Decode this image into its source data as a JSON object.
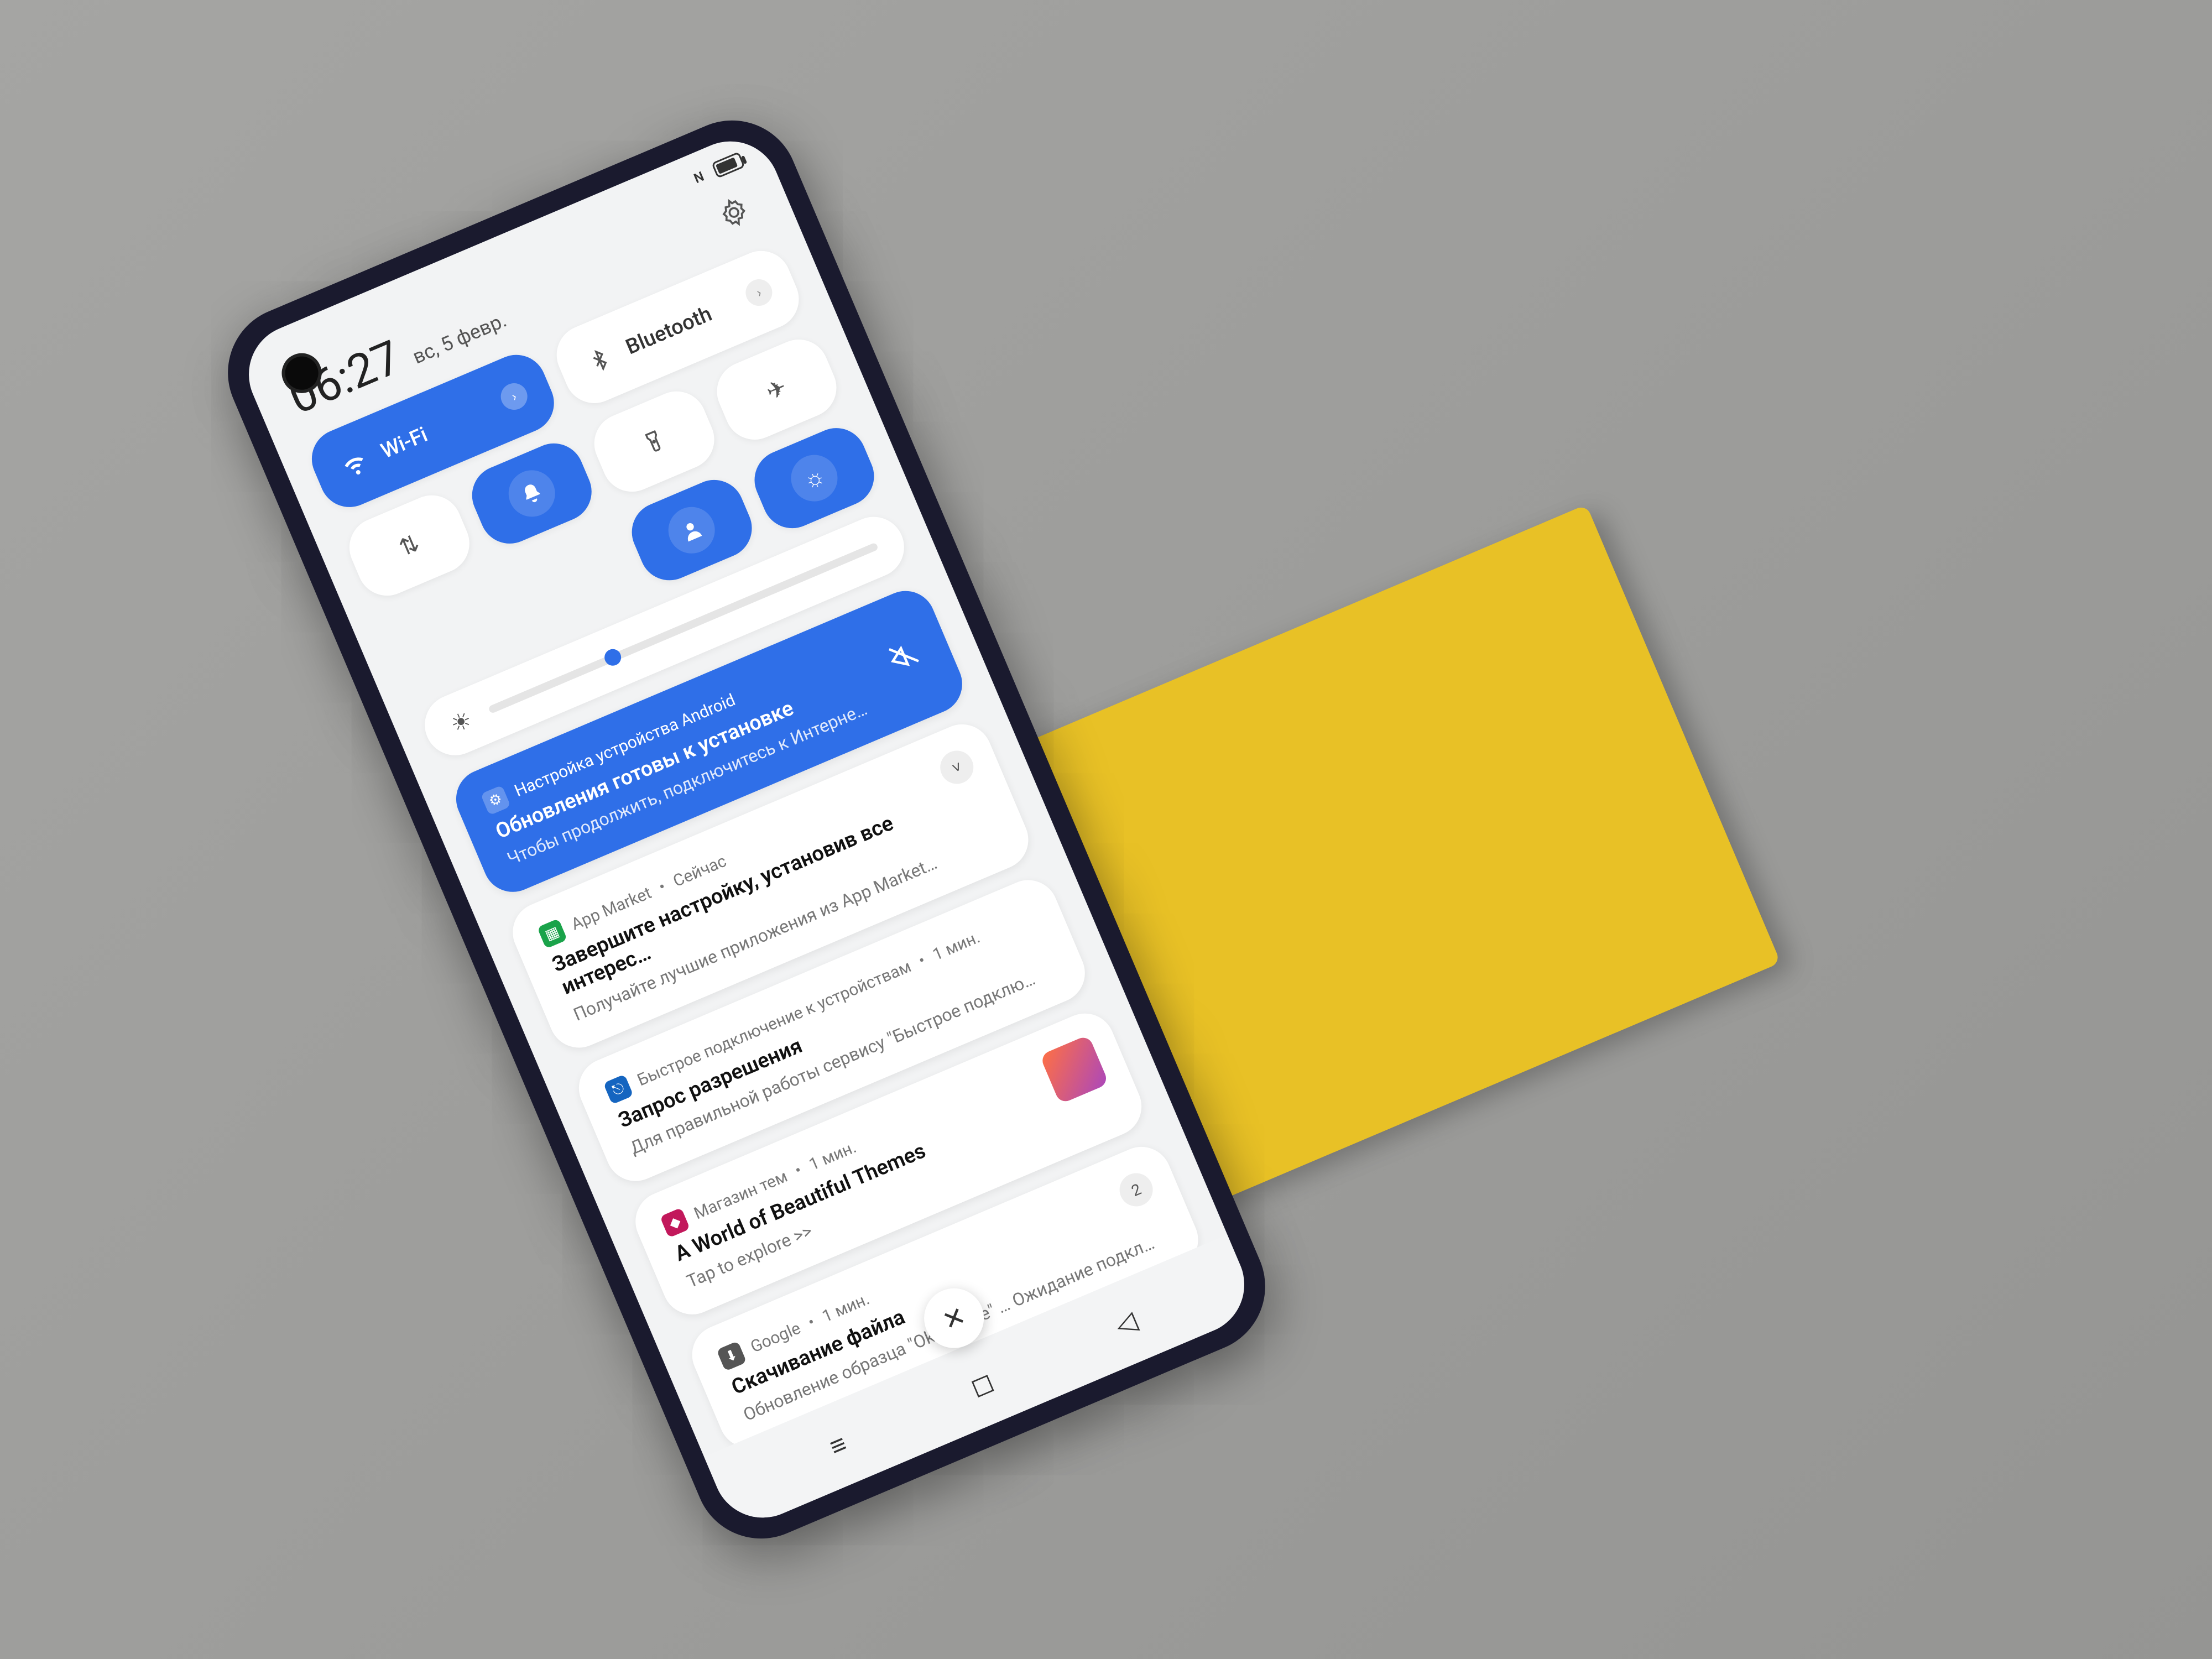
{
  "status": {
    "nfc_label": "N",
    "battery_percent": 75
  },
  "header": {
    "time": "06:27",
    "date": "вс, 5 февр."
  },
  "quick_settings": {
    "wifi": {
      "label": "Wi-Fi",
      "on": true
    },
    "data": {
      "on": false
    },
    "bluetooth": {
      "label": "Bluetooth",
      "on": false
    },
    "notif_bell": {
      "on": true
    },
    "flashlight": {
      "on": false
    },
    "airplane": {
      "on": false
    },
    "sound": {
      "on": true
    },
    "brightness_auto": {
      "on": true
    }
  },
  "notifications": [
    {
      "id": "android-setup",
      "app": "Настройка устройства Android",
      "title": "Обновления готовы к установке",
      "body": "Чтобы продолжить, подключитесь к Интерне…",
      "icon": "gear",
      "blue": true,
      "no_internet": true
    },
    {
      "id": "app-market",
      "app": "App Market",
      "time": "Сейчас",
      "title": "Завершите настройку, установив все интерес…",
      "body": "Получайте лучшие приложения из App Market…",
      "icon_color": "#1aa34a",
      "badge": "˅"
    },
    {
      "id": "quick-connect",
      "app": "Быстрое подключение к устройствам",
      "time": "1 мин.",
      "title": "Запрос разрешения",
      "body": "Для правильной работы сервису \"Быстрое подклю…",
      "icon_color": "#1565c0"
    },
    {
      "id": "themes",
      "app": "Магазин тем",
      "time": "1 мин.",
      "title": "A World of Beautiful Themes",
      "body": "Tap to explore >>",
      "icon_color": "#c2185b",
      "thumb": true
    },
    {
      "id": "google-dl",
      "app": "Google",
      "time": "1 мин.",
      "title": "Скачивание файла",
      "body": "Обновление образца \"Ok Google\" … Ожидание подкл…",
      "icon": "download",
      "badge": "2"
    }
  ],
  "clear_all": "✕",
  "nav": {
    "recents": "≡",
    "home": "◻",
    "back": "◁"
  }
}
